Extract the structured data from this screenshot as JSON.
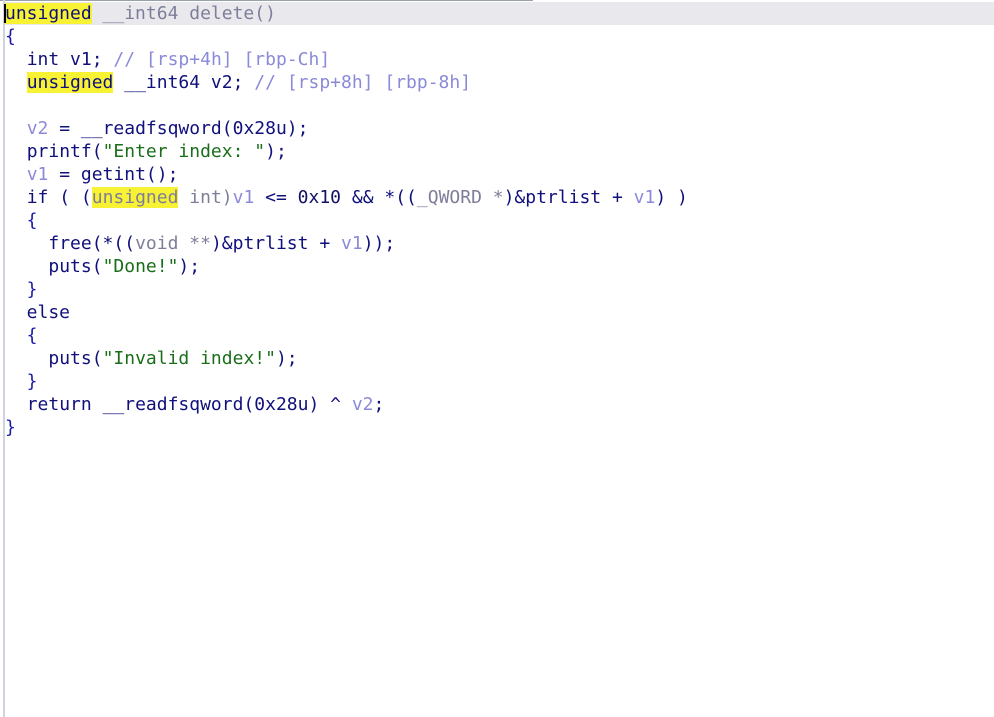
{
  "pseudocode": {
    "signature": {
      "kw": "unsigned",
      "sep": " ",
      "type": "__int64",
      "name": " delete()"
    },
    "open_brace": "{",
    "decl_v1": {
      "indent": "  ",
      "type": "int",
      "name": " v1;",
      "comment": " // ",
      "loc1": "[rsp+4h]",
      "gap": " ",
      "loc2": "[rbp-Ch]"
    },
    "decl_v2": {
      "indent": "  ",
      "kw": "unsigned",
      "sep": " ",
      "type": "__int64",
      "name": " v2;",
      "comment": " // ",
      "loc1": "[rsp+8h]",
      "gap": " ",
      "loc2": "[rbp-8h]"
    },
    "line_assign_v2": {
      "indent": "  ",
      "var": "v2",
      "op": " = ",
      "func": "__readfsqword",
      "args": "(0x28u);"
    },
    "line_printf": {
      "indent": "  ",
      "func": "printf",
      "open": "(",
      "str": "\"Enter index: \"",
      "close": ");"
    },
    "line_getint": {
      "indent": "  ",
      "var": "v1",
      "op": " = ",
      "func": "getint",
      "close": "();"
    },
    "line_if": {
      "indent": "  ",
      "kw": "if",
      "open": " ( (",
      "cast_kw": "unsigned",
      "cast_type": " int)",
      "var": "v1",
      "cmp": " <= ",
      "num": "0x10",
      "and": " && *((",
      "qword": "_QWORD *",
      "ptr": ")&ptrlist",
      "plus": " + ",
      "var2": "v1",
      "close": ") )"
    },
    "brace_if_open": "  {",
    "line_free": {
      "indent": "    ",
      "func": "free",
      "open": "(*((",
      "cast": "void **",
      "ptr": ")&ptrlist",
      "plus": " + ",
      "var": "v1",
      "close": "));"
    },
    "line_puts_done": {
      "indent": "    ",
      "func": "puts",
      "open": "(",
      "str": "\"Done!\"",
      "close": ");"
    },
    "brace_if_close": "  }",
    "line_else": "  else",
    "brace_else_open": "  {",
    "line_puts_invalid": {
      "indent": "    ",
      "func": "puts",
      "open": "(",
      "str": "\"Invalid index!\"",
      "close": ");"
    },
    "brace_else_close": "  }",
    "line_return": {
      "indent": "  ",
      "kw": "return",
      "sep": " ",
      "func": "__readfsqword",
      "args": "(0x28u) ^ ",
      "var": "v2",
      "end": ";"
    },
    "close_brace": "}"
  },
  "colors": {
    "highlight": "#f7f234",
    "keyword": "#10107c",
    "variable": "#8a8ad8",
    "string": "#1a6e1a",
    "current_line": "#e9e9ed"
  }
}
